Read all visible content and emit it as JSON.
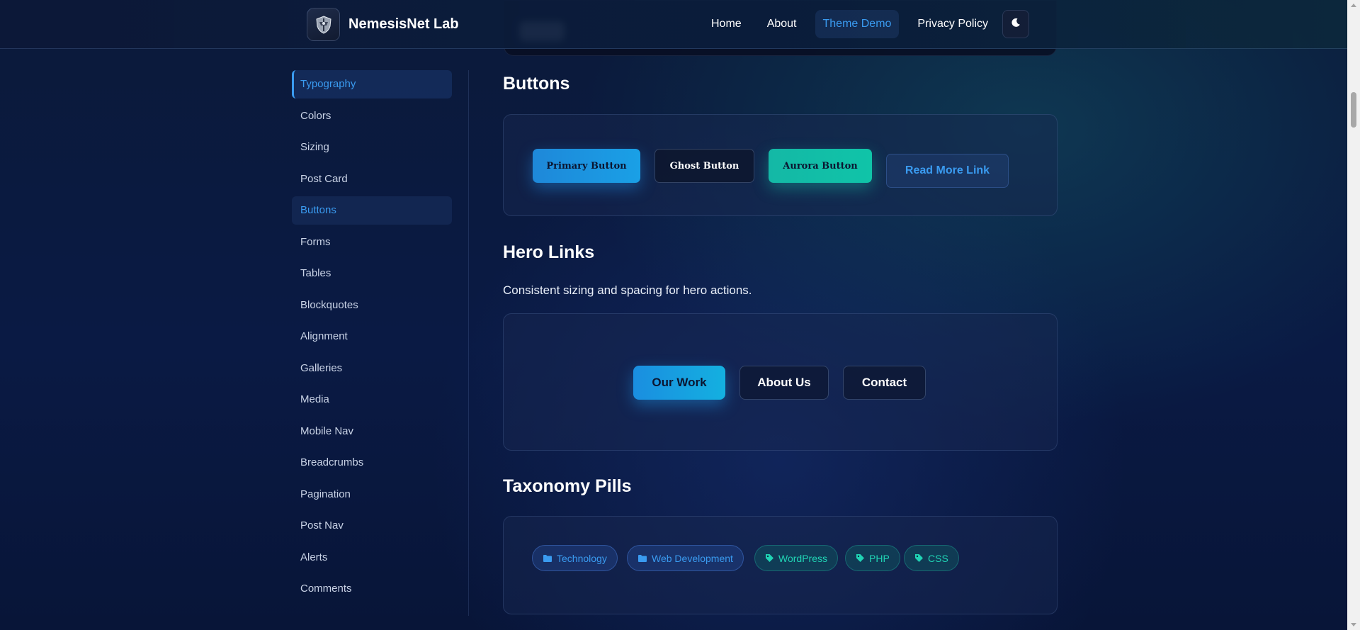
{
  "header": {
    "site_name": "NemesisNet Lab",
    "logo_icon": "shield-knight-icon",
    "nav": [
      {
        "label": "Home",
        "active": false
      },
      {
        "label": "About",
        "active": false
      },
      {
        "label": "Theme Demo",
        "active": true
      },
      {
        "label": "Privacy Policy",
        "active": false
      }
    ],
    "theme_toggle_icon": "moon-icon"
  },
  "sidebar": {
    "items": [
      {
        "label": "Typography",
        "state": "current"
      },
      {
        "label": "Colors",
        "state": ""
      },
      {
        "label": "Sizing",
        "state": ""
      },
      {
        "label": "Post Card",
        "state": ""
      },
      {
        "label": "Buttons",
        "state": "highlighted"
      },
      {
        "label": "Forms",
        "state": ""
      },
      {
        "label": "Tables",
        "state": ""
      },
      {
        "label": "Blockquotes",
        "state": ""
      },
      {
        "label": "Alignment",
        "state": ""
      },
      {
        "label": "Galleries",
        "state": ""
      },
      {
        "label": "Media",
        "state": ""
      },
      {
        "label": "Mobile Nav",
        "state": ""
      },
      {
        "label": "Breadcrumbs",
        "state": ""
      },
      {
        "label": "Pagination",
        "state": ""
      },
      {
        "label": "Post Nav",
        "state": ""
      },
      {
        "label": "Alerts",
        "state": ""
      },
      {
        "label": "Comments",
        "state": ""
      }
    ]
  },
  "buttons_section": {
    "title": "Buttons",
    "primary": "Primary Button",
    "ghost": "Ghost Button",
    "aurora": "Aurora Button",
    "read_more": "Read More Link"
  },
  "hero_links_section": {
    "title": "Hero Links",
    "description": "Consistent sizing and spacing for hero actions.",
    "our_work": "Our Work",
    "about_us": "About Us",
    "contact": "Contact"
  },
  "taxonomy_section": {
    "title": "Taxonomy Pills",
    "categories": [
      "Technology",
      "Web Development"
    ],
    "category_icon": "folder-icon",
    "tags": [
      "WordPress",
      "PHP",
      "CSS"
    ],
    "tag_icon": "tag-icon"
  },
  "colors": {
    "accent_blue": "#3a9bf0",
    "aurora_teal": "#14b8a6",
    "tag_text": "#20d3b4"
  }
}
